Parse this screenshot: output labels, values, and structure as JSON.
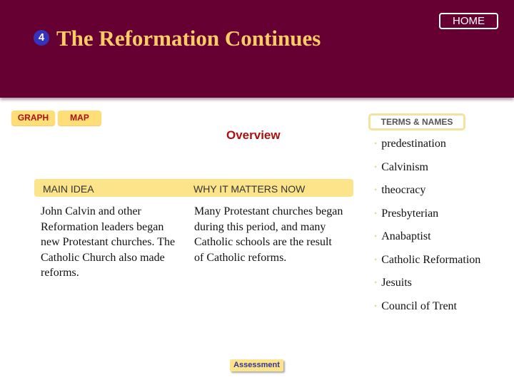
{
  "header": {
    "section_number": "4",
    "title": "The Reformation Continues",
    "home_label": "HOME"
  },
  "tabs": [
    {
      "label": "GRAPH"
    },
    {
      "label": "MAP"
    }
  ],
  "overview_label": "Overview",
  "main_idea": {
    "heading": "MAIN IDEA",
    "text": "John Calvin and other Reformation leaders began new Protestant churches. The Catholic Church also made reforms."
  },
  "why_it_matters": {
    "heading": "WHY IT MATTERS NOW",
    "text": "Many Protestant churches began during this period, and many Catholic schools are the result of Catholic reforms."
  },
  "terms": {
    "heading": "TERMS & NAMES",
    "bullet": "•",
    "items": [
      "predestination",
      "Calvinism",
      "theocracy",
      "Presbyterian",
      "Anabaptist",
      "Catholic Reformation",
      "Jesuits",
      "Council of Trent"
    ]
  },
  "assessment_label": "Assessment",
  "colors": {
    "header_bg": "#660033",
    "title_gold": "#ffcc66",
    "tab_bg": "#ffdd77",
    "accent_red": "#aa1111",
    "badge_blue": "#3333bb"
  }
}
